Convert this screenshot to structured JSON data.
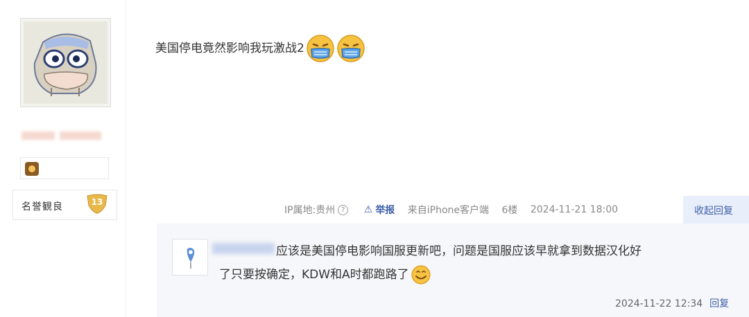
{
  "user": {
    "rank_label": "名誉観良",
    "rank_level": "13"
  },
  "post": {
    "text": "美国停电竟然影响我玩激战2",
    "emoji_name": "sick-face-emoji"
  },
  "meta": {
    "ip_location": "IP属地:贵州",
    "help_mark": "?",
    "report_label": "举报",
    "client": "来自iPhone客户端",
    "floor": "6楼",
    "time": "2024-11-21 18:00",
    "collapse_reply_label": "收起回复"
  },
  "reply": {
    "text_line1": "应该是美国停电影响国服更新吧，问题是国服应该早就拿到数据汉化好",
    "text_line2": "了只要按确定，KDW和A时都跑路了",
    "time": "2024-11-22 12:34",
    "reply_label": "回复"
  },
  "colors": {
    "link_blue": "#3d5fa6",
    "reply_bg": "#f6f7fa",
    "badge_gold": "#e9b84a"
  }
}
